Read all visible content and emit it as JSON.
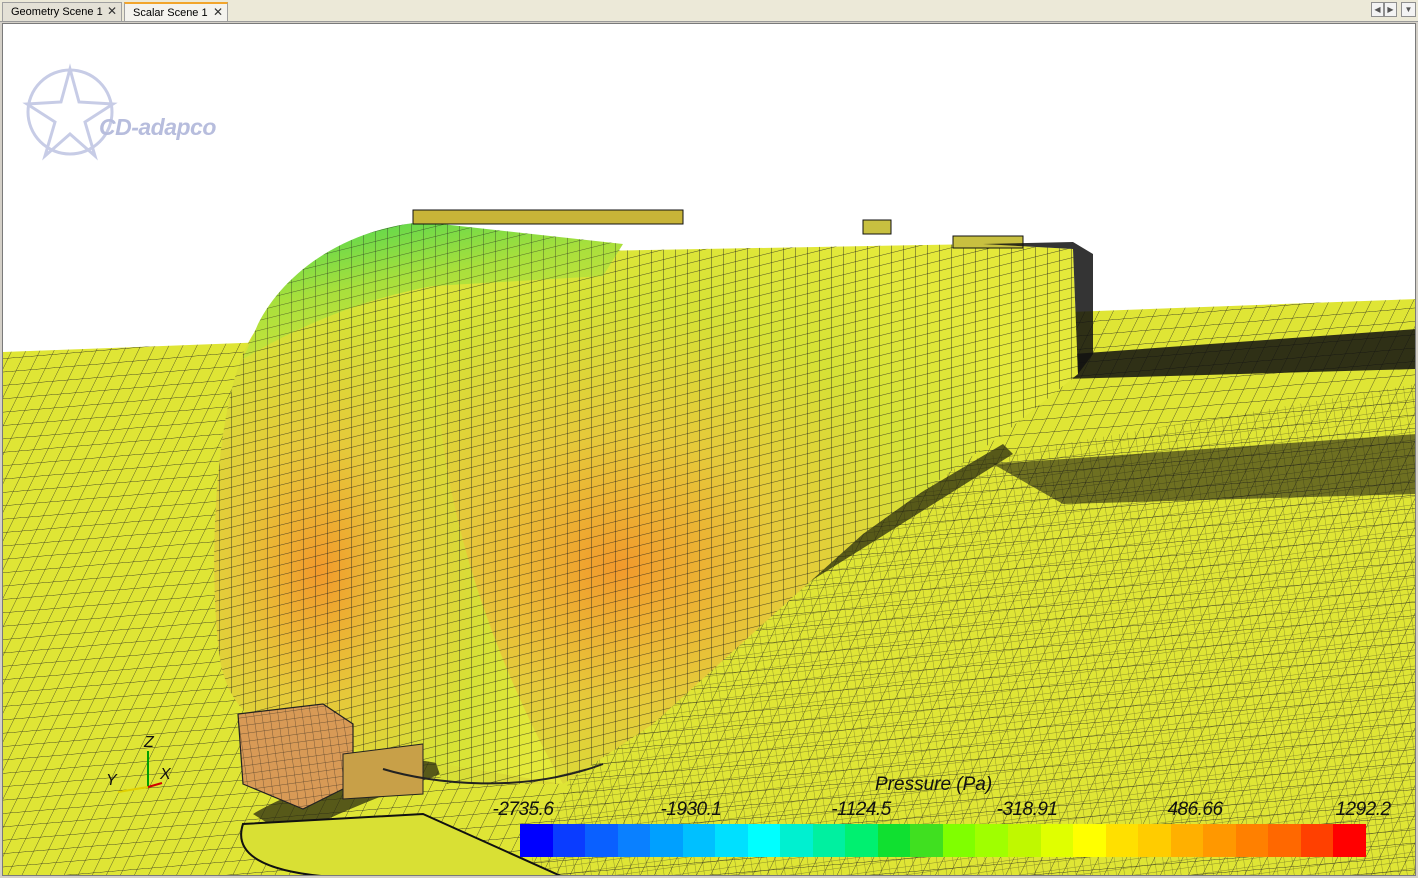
{
  "tabs": [
    {
      "label": "Geometry Scene 1",
      "active": false
    },
    {
      "label": "Scalar Scene 1",
      "active": true
    }
  ],
  "tab_close_glyph": "✕",
  "nav_buttons": [
    "◀",
    "▶",
    "▼"
  ],
  "logo": {
    "text": "CD-adapco"
  },
  "legend": {
    "title": "Pressure (Pa)",
    "ticks": [
      "-2735.6",
      "-1930.1",
      "-1124.5",
      "-318.91",
      "486.66",
      "1292.2"
    ],
    "colors": [
      "#0000ff",
      "#0a3cff",
      "#0a60ff",
      "#0a80ff",
      "#00a0ff",
      "#00c0ff",
      "#00e0ff",
      "#00ffff",
      "#00f0d0",
      "#00f0a0",
      "#00f070",
      "#10e030",
      "#40e020",
      "#80ff00",
      "#a0ff00",
      "#c0f800",
      "#e0ff00",
      "#ffff00",
      "#ffe000",
      "#ffcc00",
      "#ffb000",
      "#ff9800",
      "#ff8000",
      "#ff6800",
      "#ff4000",
      "#ff0000"
    ]
  },
  "triad": {
    "x": "X",
    "y": "Y",
    "z": "Z"
  }
}
